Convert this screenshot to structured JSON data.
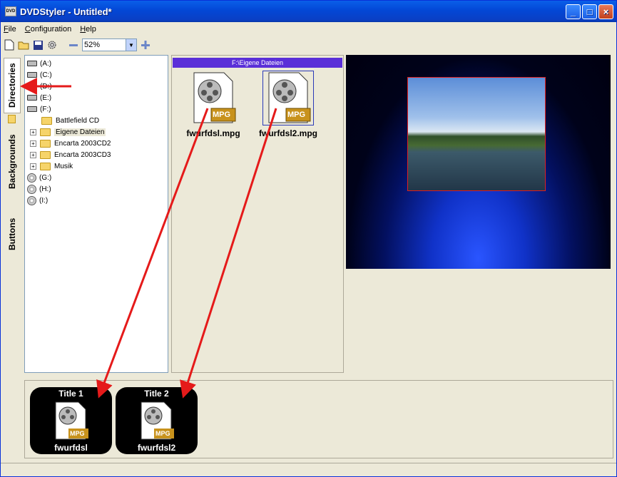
{
  "window": {
    "title": "DVDStyler - Untitled*",
    "app_icon": "DVD"
  },
  "menu": {
    "items": [
      "File",
      "Configuration",
      "Help"
    ]
  },
  "toolbar": {
    "icons": [
      "new-icon",
      "open-icon",
      "save-icon",
      "settings-icon",
      "zoom-out-icon",
      "zoom-in-icon"
    ],
    "zoom_value": "52%"
  },
  "sidetabs": {
    "directories": "Directories",
    "backgrounds": "Backgrounds",
    "buttons": "Buttons"
  },
  "tree": {
    "drives": [
      "(A:)",
      "(C:)",
      "(D:)",
      "(E:)",
      "(F:)"
    ],
    "folders": [
      "Battlefield CD",
      "Eigene Dateien",
      "Encarta 2003CD2",
      "Encarta 2003CD3",
      "Musik"
    ],
    "cd_drives": [
      "(G:)",
      "(H:)",
      "(I:)"
    ]
  },
  "filebrowser": {
    "path": "F:\\Eigene Dateien",
    "files": [
      "fwurfdsl.mpg",
      "fwurfdsl2.mpg"
    ],
    "icon_badge": "MPG"
  },
  "titles": [
    {
      "title": "Title 1",
      "name": "fwurfdsl"
    },
    {
      "title": "Title 2",
      "name": "fwurfdsl2"
    }
  ],
  "colors": {
    "annotation_arrow": "#e51a1a",
    "path_bar": "#5a2fd8",
    "titlebar": "#0347d6"
  }
}
